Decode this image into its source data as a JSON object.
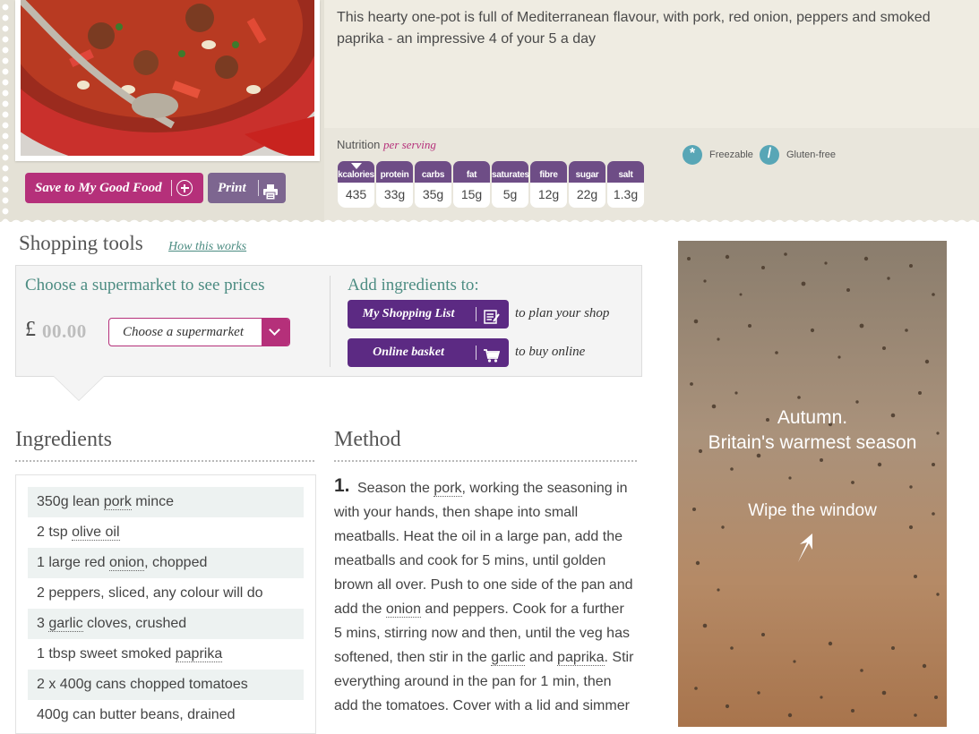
{
  "recipe": {
    "description": "This hearty one-pot is full of Mediterranean flavour, with pork, red onion, peppers and smoked paprika - an impressive 4 of your 5 a day",
    "save_label": "Save to My Good Food",
    "print_label": "Print",
    "nutrition": {
      "label": "Nutrition",
      "per_label": "per serving",
      "items": [
        {
          "name": "kcalories",
          "value": "435"
        },
        {
          "name": "protein",
          "value": "33g"
        },
        {
          "name": "carbs",
          "value": "35g"
        },
        {
          "name": "fat",
          "value": "15g"
        },
        {
          "name": "saturates",
          "value": "5g"
        },
        {
          "name": "fibre",
          "value": "12g"
        },
        {
          "name": "sugar",
          "value": "22g"
        },
        {
          "name": "salt",
          "value": "1.3g"
        }
      ]
    },
    "tags": [
      "Freezable",
      "Gluten-free"
    ]
  },
  "shopping": {
    "title": "Shopping tools",
    "how_link": "How this works",
    "choose_label": "Choose a supermarket to see prices",
    "currency": "£",
    "price": "00.00",
    "select_value": "Choose a supermarket",
    "add_label": "Add ingredients to:",
    "list_button": "My Shopping List",
    "list_note": "to plan your shop",
    "basket_button": "Online basket",
    "basket_note": "to buy online"
  },
  "ingredients": {
    "title": "Ingredients",
    "items": [
      {
        "pre": "350g lean ",
        "link": "pork",
        "post": " mince"
      },
      {
        "pre": "2 tsp ",
        "link": "olive oil",
        "post": ""
      },
      {
        "pre": "1 large red ",
        "link": "onion",
        "post": ", chopped"
      },
      {
        "pre": "2 peppers, sliced, any colour will do",
        "link": "",
        "post": ""
      },
      {
        "pre": "3 ",
        "link": "garlic",
        "post": " cloves, crushed"
      },
      {
        "pre": "1 tbsp sweet smoked ",
        "link": "paprika",
        "post": ""
      },
      {
        "pre": "2 x 400g cans chopped tomatoes",
        "link": "",
        "post": ""
      },
      {
        "pre": "400g can butter beans, drained",
        "link": "",
        "post": ""
      }
    ]
  },
  "method": {
    "title": "Method",
    "step_number": "1.",
    "lines": [
      {
        "a": "Season the ",
        "l1": "pork",
        "b": ", working the seasoning in",
        "l2": "",
        "c": ""
      },
      {
        "a": "with your hands, then shape into small",
        "l1": "",
        "b": "",
        "l2": "",
        "c": ""
      },
      {
        "a": "meatballs. Heat the oil in a large pan, add the",
        "l1": "",
        "b": "",
        "l2": "",
        "c": ""
      },
      {
        "a": "meatballs and cook for 5 mins, until golden",
        "l1": "",
        "b": "",
        "l2": "",
        "c": ""
      },
      {
        "a": "brown all over. Push to one side of the pan and",
        "l1": "",
        "b": "",
        "l2": "",
        "c": ""
      },
      {
        "a": "add the ",
        "l1": "onion",
        "b": " and peppers. Cook for a further",
        "l2": "",
        "c": ""
      },
      {
        "a": "5 mins, stirring now and then, until the veg has",
        "l1": "",
        "b": "",
        "l2": "",
        "c": ""
      },
      {
        "a": "softened, then stir in the ",
        "l1": "garlic",
        "b": " and ",
        "l2": "paprika",
        "c": ". Stir"
      },
      {
        "a": "everything around in the pan for 1 min, then",
        "l1": "",
        "b": "",
        "l2": "",
        "c": ""
      },
      {
        "a": "add the tomatoes. Cover with a lid and simmer",
        "l1": "",
        "b": "",
        "l2": "",
        "c": ""
      }
    ]
  },
  "ad": {
    "line1": "Autumn.",
    "line2": "Britain's warmest season",
    "cta": "Wipe the window"
  },
  "colors": {
    "magenta": "#b5307a",
    "purple": "#5c2a83",
    "teal_text": "#4c8c82"
  }
}
